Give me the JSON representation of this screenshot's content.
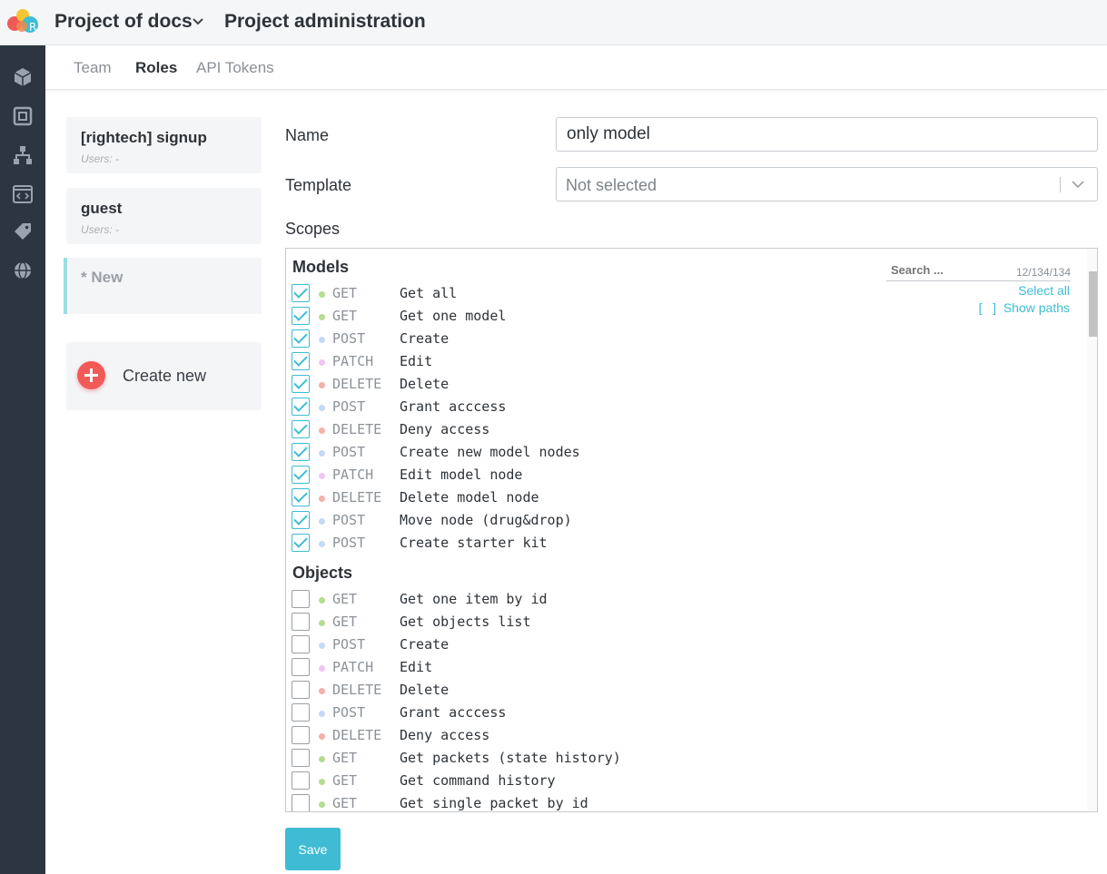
{
  "header": {
    "project_title": "Project of docs",
    "admin_title": "Project administration"
  },
  "subnav": {
    "tabs": [
      {
        "label": "Team"
      },
      {
        "label": "Roles"
      },
      {
        "label": "API Tokens"
      }
    ]
  },
  "roles": [
    {
      "name": "[rightech] signup",
      "users": "Users: -"
    },
    {
      "name": "guest",
      "users": "Users: -"
    }
  ],
  "new_role": {
    "name": "* New"
  },
  "create_new": {
    "label": "Create new"
  },
  "form": {
    "name_label": "Name",
    "name_value": "only model",
    "template_label": "Template",
    "template_value": "Not selected",
    "scopes_label": "Scopes"
  },
  "scopes": {
    "search_placeholder": "Search ...",
    "count": "12/134/134",
    "select_all": "Select all",
    "show_paths": "[   ]  Show paths",
    "sections": [
      {
        "title": "Models",
        "items": [
          {
            "method": "GET",
            "label": "Get all",
            "checked": true
          },
          {
            "method": "GET",
            "label": "Get one model",
            "checked": true
          },
          {
            "method": "POST",
            "label": "Create",
            "checked": true
          },
          {
            "method": "PATCH",
            "label": "Edit",
            "checked": true
          },
          {
            "method": "DELETE",
            "label": "Delete",
            "checked": true
          },
          {
            "method": "POST",
            "label": "Grant acccess",
            "checked": true
          },
          {
            "method": "DELETE",
            "label": "Deny access",
            "checked": true
          },
          {
            "method": "POST",
            "label": "Create new model nodes",
            "checked": true
          },
          {
            "method": "PATCH",
            "label": "Edit model node",
            "checked": true
          },
          {
            "method": "DELETE",
            "label": "Delete model node",
            "checked": true
          },
          {
            "method": "POST",
            "label": "Move node (drug&drop)",
            "checked": true
          },
          {
            "method": "POST",
            "label": "Create starter kit",
            "checked": true
          }
        ]
      },
      {
        "title": "Objects",
        "items": [
          {
            "method": "GET",
            "label": "Get one item by id",
            "checked": false
          },
          {
            "method": "GET",
            "label": "Get objects list",
            "checked": false
          },
          {
            "method": "POST",
            "label": "Create",
            "checked": false
          },
          {
            "method": "PATCH",
            "label": "Edit",
            "checked": false
          },
          {
            "method": "DELETE",
            "label": "Delete",
            "checked": false
          },
          {
            "method": "POST",
            "label": "Grant acccess",
            "checked": false
          },
          {
            "method": "DELETE",
            "label": "Deny access",
            "checked": false
          },
          {
            "method": "GET",
            "label": "Get packets (state history)",
            "checked": false
          },
          {
            "method": "GET",
            "label": "Get command history",
            "checked": false
          },
          {
            "method": "GET",
            "label": "Get single packet by id",
            "checked": false
          }
        ]
      }
    ]
  },
  "method_colors": {
    "GET": "#b5dd8f",
    "POST": "#c5d9f5",
    "PATCH": "#efc6f2",
    "DELETE": "#f4b0ab"
  },
  "save": {
    "label": "Save"
  },
  "sidebar_icons": [
    "cube-icon",
    "square-frame-icon",
    "hierarchy-icon",
    "code-window-icon",
    "tag-icon",
    "globe-icon"
  ]
}
